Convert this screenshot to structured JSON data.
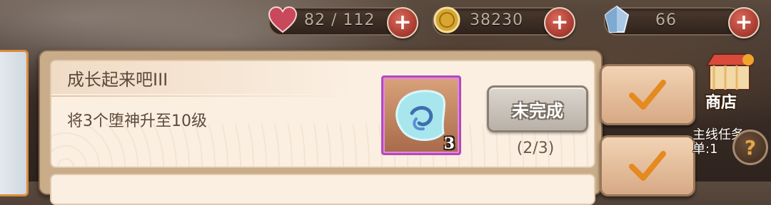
{
  "resources": {
    "stamina": {
      "value": "82 / 112",
      "icon": "heart-icon"
    },
    "gold": {
      "value": "38230",
      "icon": "coin-icon"
    },
    "gems": {
      "value": "66",
      "icon": "crystal-icon"
    },
    "add_label": "+"
  },
  "task": {
    "title": "成长起来吧III",
    "description": "将3个堕神升至10级",
    "reward": {
      "icon": "blue-talisman-icon",
      "quantity": "3"
    },
    "status_label": "未完成",
    "progress": "(2/3)"
  },
  "side": {
    "shop_label": "商店",
    "task_text": "主线任务\n单:1",
    "help_label": "?"
  },
  "colors": {
    "panel": "#fbefe2",
    "accent_check": "#e58a1f",
    "reward_border": "#b34bb5",
    "add_button": "#c0392b"
  }
}
